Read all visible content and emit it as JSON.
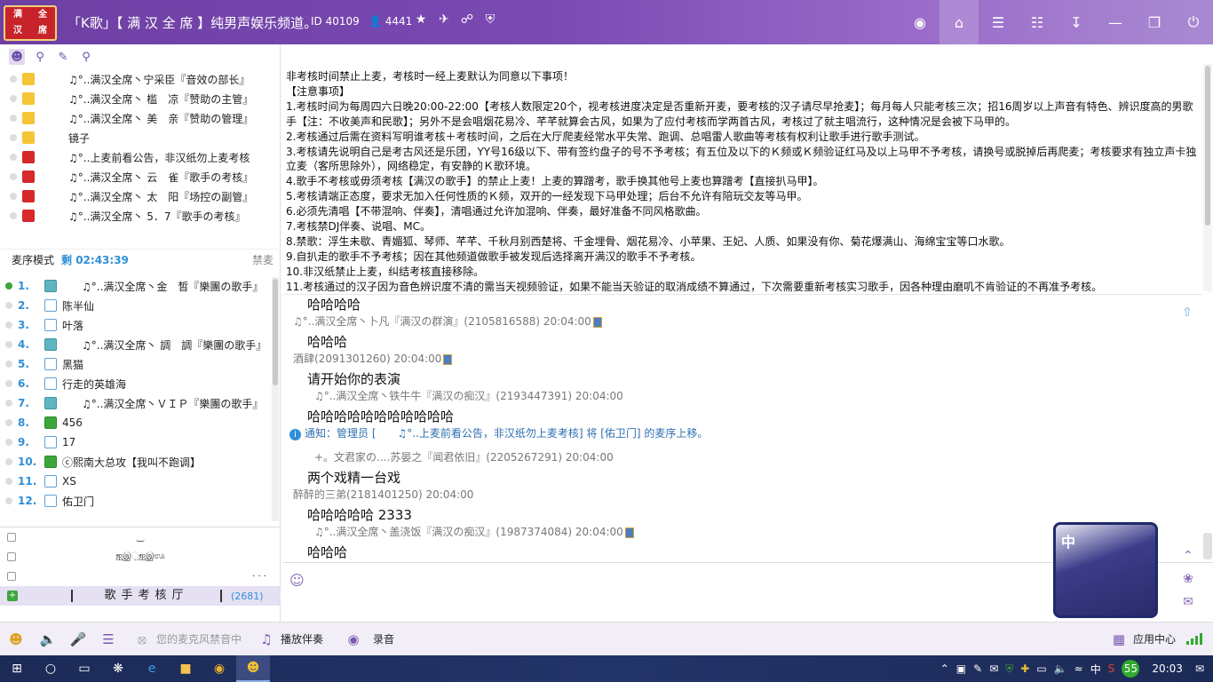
{
  "titlebar": {
    "logo_chars": [
      "满",
      "全",
      "汉",
      "席"
    ],
    "title": "「K歌」【 满 汉 全 席 】纯男声娱乐频道。",
    "id_text": "ID 40109",
    "users_count": "4441",
    "icons": [
      "star-icon",
      "plane-icon",
      "share-icon",
      "shield-icon"
    ],
    "right_icons": [
      "camera-icon",
      "home-icon",
      "list-icon",
      "gamepad-icon",
      "download-icon",
      "minimize-icon",
      "maximize-icon",
      "power-icon"
    ]
  },
  "left": {
    "tools": [
      "user-icon",
      "location-icon",
      "record-icon",
      "search-icon"
    ],
    "admins": [
      {
        "name": "♫°..满汉全席丶宁采臣『音效の部长』",
        "color": "yellow"
      },
      {
        "name": "♫°..满汉全席丶 槛　凉『赞助の主管』",
        "color": "yellow"
      },
      {
        "name": "♫°..满汉全席丶 美　亲『赞助の管理』",
        "color": "yellow"
      },
      {
        "name": "镜子",
        "color": "yellow"
      },
      {
        "name": "♫°..上麦前看公告，非汉纸勿上麦考核",
        "color": "red"
      },
      {
        "name": "♫°..满汉全席丶 云　雀『歌手の考核』",
        "color": "red"
      },
      {
        "name": "♫°..满汉全席丶 太　阳『场控の副管』",
        "color": "red"
      },
      {
        "name": "♫°..满汉全席丶 5．7『歌手の考核』",
        "color": "red"
      }
    ],
    "queue_mode": "麦序模式",
    "queue_time": "剩 02:43:39",
    "queue_clear": "禁麦",
    "queue": [
      {
        "num": "1.",
        "name": "♫°..满汉全席丶金　皙『樂團の歌手』",
        "shirt": "teal"
      },
      {
        "num": "2.",
        "name": "陈半仙",
        "shirt": ""
      },
      {
        "num": "3.",
        "name": "叶落",
        "shirt": ""
      },
      {
        "num": "4.",
        "name": "♫°..满汉全席丶 調　調『樂團の歌手』",
        "shirt": "teal"
      },
      {
        "num": "5.",
        "name": "黑猫",
        "shirt": ""
      },
      {
        "num": "6.",
        "name": "行走的英雄海",
        "shirt": ""
      },
      {
        "num": "7.",
        "name": "♫°..满汉全席丶ＶＩＰ『樂團の歌手』",
        "shirt": "teal"
      },
      {
        "num": "8.",
        "name": "456",
        "shirt": "green"
      },
      {
        "num": "9.",
        "name": "17",
        "shirt": ""
      },
      {
        "num": "10.",
        "name": "ⓒ熙南大总攻【我叫不跑调】",
        "shirt": "green"
      },
      {
        "num": "11.",
        "name": "XS",
        "shirt": ""
      },
      {
        "num": "12.",
        "name": "佑卫门",
        "shirt": ""
      }
    ],
    "channel": {
      "row1": "‿",
      "row2": "ஐஇ಼ஐஇಊ",
      "row3": "· · ·",
      "name": "歌手考核厅",
      "count": "(2681)"
    }
  },
  "notice": [
    "非考核时间禁止上麦，考核时一经上麦默认为同意以下事项！",
    "【注意事项】",
    "1.考核时间为每周四六日晚20:00-22:00【考核人数限定20个，视考核进度决定是否重新开麦，要考核的汉子请尽早抢麦】；每月每人只能考核三次；招16周岁以上声音有特色、辨识度高的男歌手【注：不收美声和民歌】；另外不是会唱烟花易冷、芊芊就算会古风，如果为了应付考核而学两首古风，考核过了就主唱流行，这种情况是会被下马甲的。",
    "2.考核通过后需在资料写明谁考核＋考核时间，之后在大厅爬麦经常水平失常、跑调、总唱雷人歌曲等考核有权利让歌手进行歌手测试。",
    "3.考核请先说明自己是考古风还是乐团，YY号16级以下、带有签约盘子的号不予考核；有五位及以下的Ｋ频或Ｋ频验证红马及以上马甲不予考核，请换号或脱掉后再爬麦；考核要求有独立声卡独立麦（客所思除外），网络稳定，有安静的Ｋ歌环境。",
    "4.歌手不考核或毋须考核【满汉の歌手】的禁止上麦！上麦的算蹭考，歌手换其他号上麦也算蹭考【直接扒马甲】。",
    "5.考核请端正态度，要求无加入任何性质的Ｋ频，双开的一经发现下马甲处理；后台不允许有陪玩交友等马甲。",
    "6.必须先清唱【不带混响、伴奏】，清唱通过允许加混响、伴奏，最好准备不同风格歌曲。",
    "7.考核禁DJ伴奏、说唱、MC。",
    "8.禁歌：浮生未歇、青媚狐、琴师、芊芊、千秋月别西楚将、千金埋骨、烟花易冷、小苹果、王妃、人质、如果没有你、菊花爆满山、海绵宝宝等口水歌。",
    "9.自扒走的歌手不予考核；因在其他频道做歌手被发现后选择离开满汉的歌手不予考核。",
    "10.非汉纸禁止上麦，纠结考核直接移除。",
    "11.考核通过的汉子因为音色辨识度不清的需当天视频验证，如果不能当天验证的取消成绩不算通过，下次需要重新考核实习歌手，因各种理由磨叽不肯验证的不再准予考核。"
  ],
  "chat": {
    "lines": [
      {
        "kind": "big",
        "text": "哈哈哈哈"
      },
      {
        "kind": "meta",
        "text": "♫°..满汉全席丶卜凡『满汉の群演』(2105816588) 20:04:00",
        "phone": true
      },
      {
        "kind": "big",
        "text": "哈哈哈"
      },
      {
        "kind": "meta",
        "text": "酒肆(2091301260) 20:04:00",
        "phone": true
      },
      {
        "kind": "big",
        "text": "请开始你的表演"
      },
      {
        "kind": "meta",
        "text": "♫°..满汉全席丶铁牛牛『满汉の痴汉』(2193447391) 20:04:00",
        "phone": false
      },
      {
        "kind": "big",
        "text": "哈哈哈哈哈哈哈哈哈哈哈"
      },
      {
        "kind": "notice",
        "text": "通知：管理员 [　　♫°..上麦前看公告，非汉纸勿上麦考核] 将 [佑卫门] 的麦序上移。"
      },
      {
        "kind": "meta",
        "text": "+。文君家の....苏晏之『闻君依旧』(2205267291) 20:04:00",
        "phone": false
      },
      {
        "kind": "big",
        "text": "两个戏精一台戏"
      },
      {
        "kind": "meta",
        "text": "醉醉的三弟(2181401250) 20:04:00",
        "phone": false
      },
      {
        "kind": "big",
        "text": "哈哈哈哈哈 2333"
      },
      {
        "kind": "meta",
        "text": "♫°..满汉全席丶盖浇饭『满汉の痴汉』(1987374084) 20:04:00",
        "phone": true
      },
      {
        "kind": "big",
        "text": "哈哈哈"
      }
    ]
  },
  "avatar": {
    "label": "中"
  },
  "bottombar": {
    "mic_disabled": "您的麦克风禁音中",
    "play": "播放伴奏",
    "record": "录音",
    "app_center": "应用中心"
  },
  "taskbar": {
    "ime": "中",
    "badge": "55",
    "time": "20:03"
  }
}
